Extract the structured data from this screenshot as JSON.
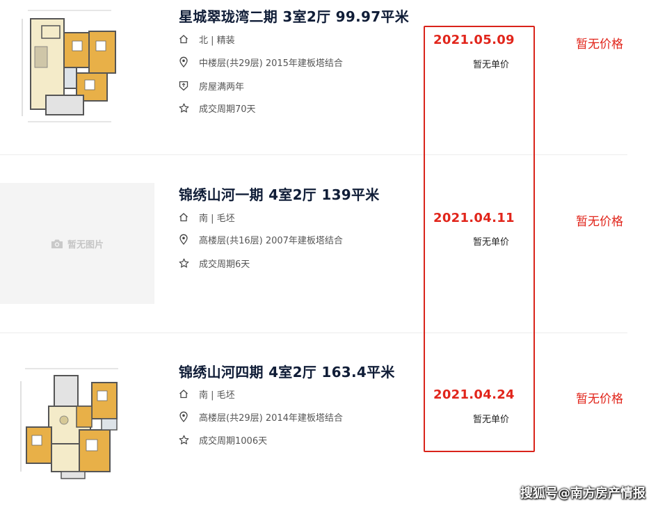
{
  "listings": [
    {
      "title": "星城翠珑湾二期 3室2厅 99.97平米",
      "orientation_decoration": "北 | 精装",
      "floor_info": "中楼层(共29层) 2015年建板塔结合",
      "tag": "房屋满两年",
      "cycle": "成交周期70天",
      "deal_date": "2021.05.09",
      "unit_price": "暂无单价",
      "total_price": "暂无价格",
      "has_image": true
    },
    {
      "title": "锦绣山河一期 4室2厅 139平米",
      "orientation_decoration": "南 | 毛坯",
      "floor_info": "高楼层(共16层) 2007年建板塔结合",
      "cycle": "成交周期6天",
      "deal_date": "2021.04.11",
      "unit_price": "暂无单价",
      "total_price": "暂无价格",
      "has_image": false,
      "no_image_text": "暂无图片"
    },
    {
      "title": "锦绣山河四期 4室2厅 163.4平米",
      "orientation_decoration": "南 | 毛坯",
      "floor_info": "高楼层(共29层) 2014年建板塔结合",
      "cycle": "成交周期1006天",
      "deal_date": "2021.04.24",
      "unit_price": "暂无单价",
      "total_price": "暂无价格",
      "has_image": true
    }
  ],
  "watermark": "搜狐号@南方房产情报",
  "colors": {
    "accent_red": "#e1251b",
    "title": "#101d37",
    "highlight_border": "#d9231a"
  },
  "icons": [
    "house-icon",
    "location-pin-icon",
    "shield-icon",
    "star-icon",
    "camera-icon"
  ]
}
